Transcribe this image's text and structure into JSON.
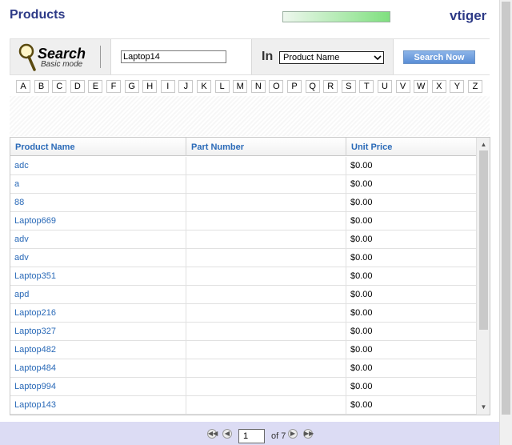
{
  "header": {
    "title": "Products",
    "brand": "vtiger"
  },
  "search": {
    "logo_title": "Search",
    "logo_subtitle": "Basic mode",
    "query_value": "Laptop14",
    "in_label": "In",
    "field_selected": "Product Name",
    "button_label": "Search Now"
  },
  "alphabet": [
    "A",
    "B",
    "C",
    "D",
    "E",
    "F",
    "G",
    "H",
    "I",
    "J",
    "K",
    "L",
    "M",
    "N",
    "O",
    "P",
    "Q",
    "R",
    "S",
    "T",
    "U",
    "V",
    "W",
    "X",
    "Y",
    "Z"
  ],
  "table": {
    "columns": [
      "Product Name",
      "Part Number",
      "Unit Price"
    ],
    "rows": [
      {
        "name": "adc",
        "part": "",
        "price": "$0.00"
      },
      {
        "name": "a",
        "part": "",
        "price": "$0.00"
      },
      {
        "name": "88",
        "part": "",
        "price": "$0.00"
      },
      {
        "name": "Laptop669",
        "part": "",
        "price": "$0.00"
      },
      {
        "name": "adv",
        "part": "",
        "price": "$0.00"
      },
      {
        "name": "adv",
        "part": "",
        "price": "$0.00"
      },
      {
        "name": "Laptop351",
        "part": "",
        "price": "$0.00"
      },
      {
        "name": "apd",
        "part": "",
        "price": "$0.00"
      },
      {
        "name": "Laptop216",
        "part": "",
        "price": "$0.00"
      },
      {
        "name": "Laptop327",
        "part": "",
        "price": "$0.00"
      },
      {
        "name": "Laptop482",
        "part": "",
        "price": "$0.00"
      },
      {
        "name": "Laptop484",
        "part": "",
        "price": "$0.00"
      },
      {
        "name": "Laptop994",
        "part": "",
        "price": "$0.00"
      },
      {
        "name": "Laptop143",
        "part": "",
        "price": "$0.00"
      }
    ]
  },
  "pager": {
    "current_page": "1",
    "of_label": "of 7"
  }
}
